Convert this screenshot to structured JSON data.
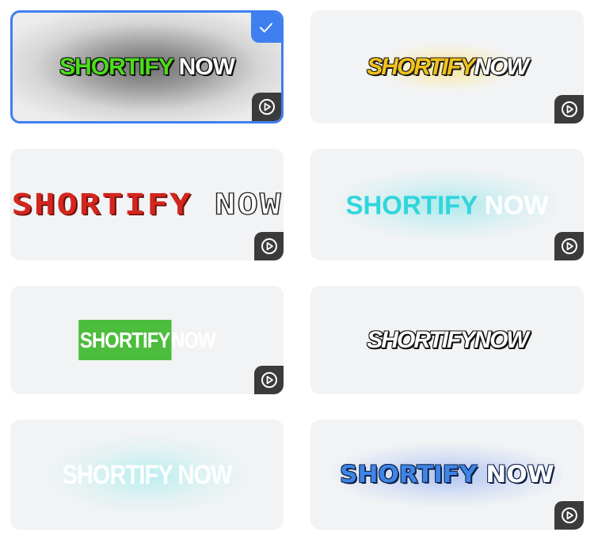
{
  "colors": {
    "card_background": "#f2f3f4",
    "selection_accent": "#3f7ff0",
    "play_badge": "#3b3b3b"
  },
  "icons": {
    "check": "check-icon",
    "play": "play-circle-icon"
  },
  "caption_styles": [
    {
      "id": "green-white-bold",
      "word1": "SHORTIFY",
      "word2": "NOW",
      "selected": true
    },
    {
      "id": "yellow-comic",
      "word1": "SHORTIFY",
      "word2": "NOW",
      "selected": false
    },
    {
      "id": "red-pixel",
      "word1": "SHORTIFY",
      "word2": "NOW",
      "selected": false
    },
    {
      "id": "cyan-glow",
      "word1": "SHORTIFY",
      "word2": "NOW",
      "selected": false
    },
    {
      "id": "green-highlight",
      "word1": "SHORTIFY",
      "word2": "NOW",
      "selected": false
    },
    {
      "id": "white-comic-outline",
      "word1": "SHORTIFY",
      "word2": "NOW",
      "selected": false
    },
    {
      "id": "white-soft-glow",
      "word1": "SHORTIFY",
      "word2": "NOW",
      "selected": false
    },
    {
      "id": "blue-pixel-glow",
      "word1": "SHORTIFY",
      "word2": "NOW",
      "selected": false
    }
  ]
}
